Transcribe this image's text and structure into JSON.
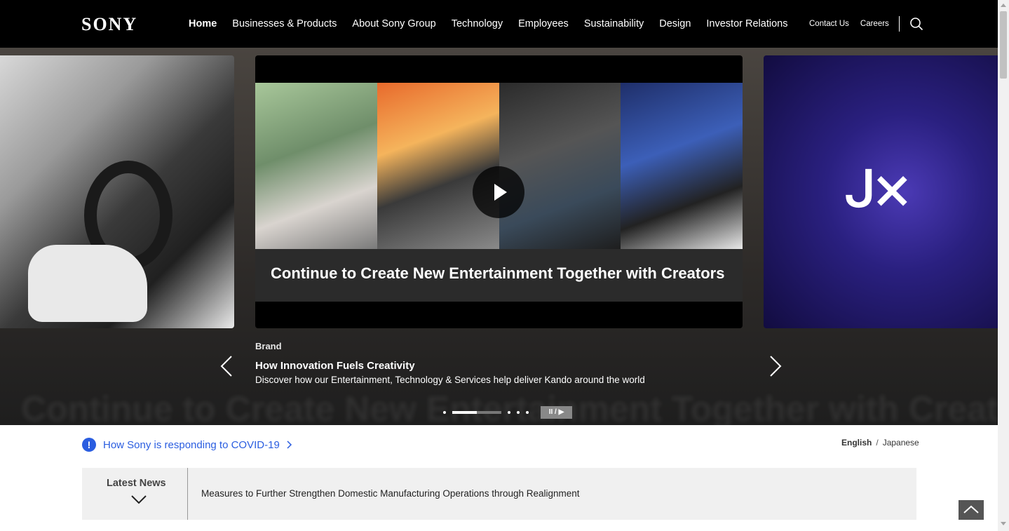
{
  "header": {
    "logo": "SONY",
    "nav": [
      {
        "label": "Home",
        "active": true
      },
      {
        "label": "Businesses & Products"
      },
      {
        "label": "About Sony Group"
      },
      {
        "label": "Technology"
      },
      {
        "label": "Employees"
      },
      {
        "label": "Sustainability"
      },
      {
        "label": "Design"
      },
      {
        "label": "Investor Relations"
      }
    ],
    "utility": [
      "Contact Us",
      "Careers"
    ],
    "search_icon": "search-icon"
  },
  "carousel": {
    "center_caption": "Continue to Create New Entertainment Together with Creators",
    "background_text": "Continue to Create New Entertainment Together with Creators",
    "category": "Brand",
    "title": "How Innovation Fuels Creativity",
    "description": "Discover how our Entertainment, Technology & Services help deliver Kando around the world",
    "progress": 0.5,
    "pause_label": "II / ▶"
  },
  "covid": {
    "icon": "!",
    "link_text": "How Sony is responding to COVID-19"
  },
  "language": {
    "current": "English",
    "other": "Japanese"
  },
  "news": {
    "label": "Latest News",
    "headline": "Measures to Further Strengthen Domestic Manufacturing Operations through Realignment"
  },
  "colors": {
    "header_bg": "#000000",
    "link_blue": "#2a5de0",
    "news_bg": "#f0f0f0"
  }
}
